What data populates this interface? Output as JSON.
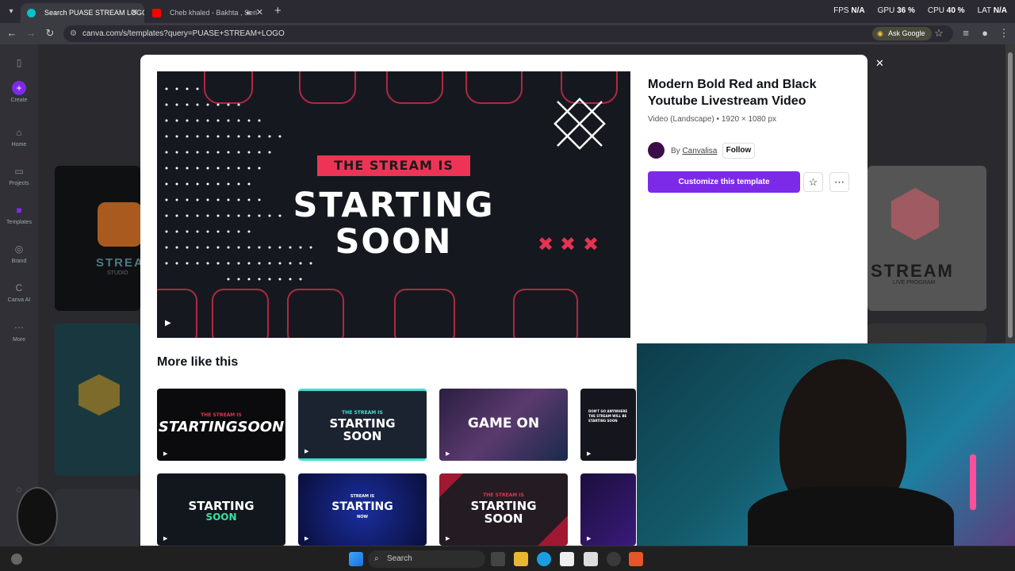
{
  "browser": {
    "tabs": [
      {
        "title": "Search PUASE STREAM LOGO",
        "active": true
      },
      {
        "title": "Cheb khaled - Bakhta , Seri",
        "active": false
      }
    ],
    "url": "canva.com/s/templates?query=PUASE+STREAM+LOGO",
    "ask_google": "Ask Google",
    "stats": {
      "fps_label": "FPS",
      "fps": "N/A",
      "gpu_label": "GPU",
      "gpu": "36 %",
      "cpu_label": "CPU",
      "cpu": "40 %",
      "lat_label": "LAT",
      "lat": "N/A"
    }
  },
  "sidebar": {
    "items": [
      {
        "label": "Create",
        "icon": "plus-icon"
      },
      {
        "label": "Home",
        "icon": "home-icon"
      },
      {
        "label": "Projects",
        "icon": "folder-icon"
      },
      {
        "label": "Templates",
        "icon": "templates-icon"
      },
      {
        "label": "Brand",
        "icon": "brand-icon"
      },
      {
        "label": "Canva AI",
        "icon": "canva-ai-icon"
      },
      {
        "label": "More",
        "icon": "more-icon"
      }
    ]
  },
  "background_cards": {
    "left_top": "STREAM",
    "left_top_sub": "STUDIO",
    "right_top": "STREAM",
    "right_top_sub": "LIVE PROGRAM"
  },
  "modal": {
    "preview": {
      "banner": "THE STREAM IS",
      "line1": "STARTING",
      "line2": "SOON"
    },
    "title": "Modern Bold Red and Black Youtube Livestream Video",
    "subtitle": "Video (Landscape) • 1920 × 1080 px",
    "author_prefix": "By",
    "author_name": "Canvalisa",
    "follow_label": "Follow",
    "customize_label": "Customize this template",
    "more_title": "More like this",
    "thumbnails": [
      {
        "line1": "THE STREAM IS",
        "line2": "STARTINGSOON",
        "bg": "#0b0b0d"
      },
      {
        "line1": "THE STREAM IS",
        "line2": "STARTING",
        "line3": "SOON",
        "bg": "#1c2330"
      },
      {
        "line1": "GAME ON",
        "bg": "#3a2a55"
      },
      {
        "line1": "DON'T GO ANYWHERE",
        "line2": "THE STREAM WILL BE",
        "line3": "STARTING SOON",
        "bg": "#15161d"
      },
      {
        "line1": "STARTING",
        "line2": "SOON",
        "bg": "#11171d"
      },
      {
        "line1": "STREAM IS",
        "line2": "STARTING",
        "line3": "NOW",
        "bg": "#0d1a5a"
      },
      {
        "line1": "THE STREAM IS",
        "line2": "STARTING",
        "line3": "SOON",
        "bg": "#241c22"
      },
      {
        "bg": "#1b0f3d"
      }
    ]
  },
  "taskbar": {
    "search_label": "Search"
  }
}
